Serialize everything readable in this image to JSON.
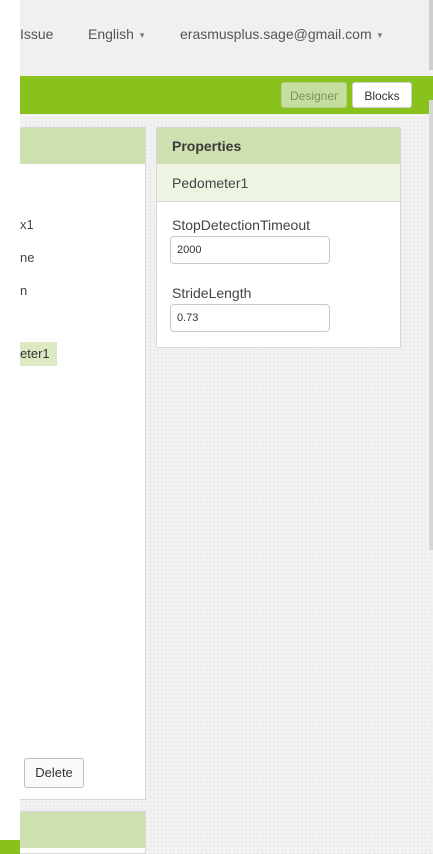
{
  "topnav": {
    "issue_label": "Issue",
    "language": "English",
    "account": "erasmusplus.sage@gmail.com"
  },
  "toolbar": {
    "designer_label": "Designer",
    "blocks_label": "Blocks"
  },
  "components": {
    "items": [
      "x1",
      "ne",
      "n"
    ],
    "selected": "eter1",
    "delete_label": "Delete"
  },
  "properties": {
    "title": "Properties",
    "component": "Pedometer1",
    "fields": [
      {
        "label": "StopDetectionTimeout",
        "value": "2000"
      },
      {
        "label": "StrideLength",
        "value": "0.73"
      }
    ]
  },
  "colors": {
    "accent_green": "#89c11d",
    "panel_header": "#cfe0b0"
  }
}
